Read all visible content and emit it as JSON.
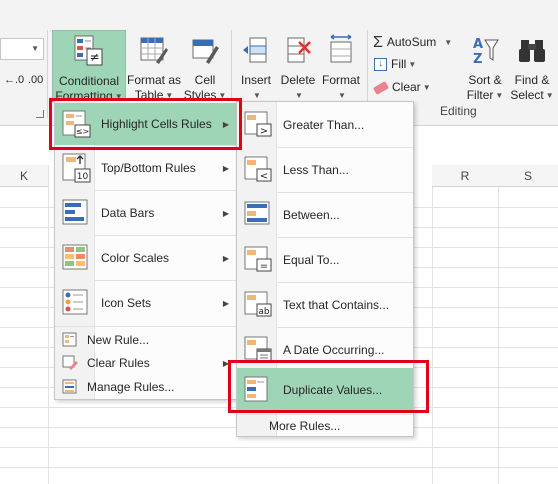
{
  "ribbon": {
    "styles_group": {
      "conditional_formatting": {
        "line1": "Conditional",
        "line2": "Formatting"
      },
      "format_as_table": {
        "line1": "Format as",
        "line2": "Table"
      },
      "cell_styles": {
        "line1": "Cell",
        "line2": "Styles"
      }
    },
    "cells_group": {
      "insert": "Insert",
      "delete": "Delete",
      "format": "Format"
    },
    "editing_group": {
      "autosum": "AutoSum",
      "fill": "Fill",
      "clear": "Clear",
      "sort_filter": {
        "line1": "Sort &",
        "line2": "Filter"
      },
      "find_select": {
        "line1": "Find &",
        "line2": "Select"
      },
      "label": "Editing"
    },
    "number_group": {
      "increase_decimal": "←.0",
      "decrease_decimal": ".00"
    }
  },
  "sheet": {
    "columns": [
      "K",
      "R",
      "S"
    ]
  },
  "cf_menu": {
    "items": [
      {
        "label": "Highlight Cells Rules",
        "has_submenu": true
      },
      {
        "label": "Top/Bottom Rules",
        "has_submenu": true
      },
      {
        "label": "Data Bars",
        "has_submenu": true
      },
      {
        "label": "Color Scales",
        "has_submenu": true
      },
      {
        "label": "Icon Sets",
        "has_submenu": true
      }
    ],
    "commands": [
      {
        "label": "New Rule..."
      },
      {
        "label": "Clear Rules"
      },
      {
        "label": "Manage Rules..."
      }
    ]
  },
  "highlight_submenu": {
    "items": [
      {
        "label": "Greater Than..."
      },
      {
        "label": "Less Than..."
      },
      {
        "label": "Between..."
      },
      {
        "label": "Equal To..."
      },
      {
        "label": "Text that Contains..."
      },
      {
        "label": "A Date Occurring..."
      },
      {
        "label": "Duplicate Values..."
      }
    ],
    "more": "More Rules..."
  },
  "colors": {
    "highlight": "#9fd5b7",
    "callout_border": "#e0001b",
    "ribbon_bg": "#f3f3f3"
  }
}
